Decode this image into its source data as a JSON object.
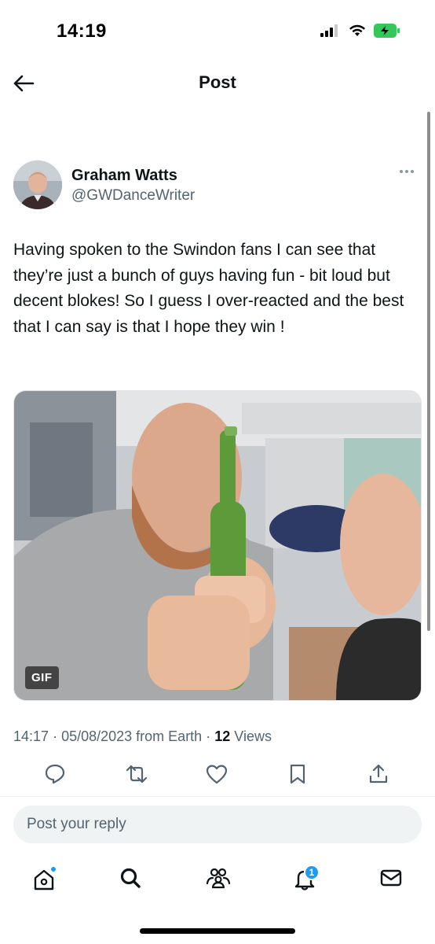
{
  "status_bar": {
    "time": "14:19"
  },
  "header": {
    "title": "Post"
  },
  "post": {
    "author_name": "Graham Watts",
    "author_handle": "@GWDanceWriter",
    "text": "Having spoken to the Swindon fans I can see that they’re just a bunch of guys having fun - bit loud  but decent blokes! So I guess I over-reacted and the best that I can say is that I hope they win !",
    "media_badge": "GIF",
    "time": "14:17",
    "date": "05/08/2023",
    "source": "from Earth",
    "views_count": "12",
    "views_label": "Views"
  },
  "actions": [
    "reply-icon",
    "repost-icon",
    "like-icon",
    "bookmark-icon",
    "share-icon"
  ],
  "reply": {
    "placeholder": "Post your reply"
  },
  "tabbar": {
    "items": [
      "home-icon",
      "search-icon",
      "communities-icon",
      "notifications-icon",
      "messages-icon"
    ],
    "notifications_count": "1"
  },
  "colors": {
    "accent": "#1d9bf0",
    "text": "#0f1419",
    "secondary": "#536471",
    "battery": "#34c759"
  }
}
